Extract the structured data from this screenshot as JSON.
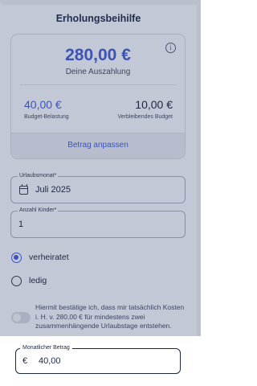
{
  "header": {
    "title": "Erholungsbeihilfe"
  },
  "summary": {
    "payout_amount": "280,00 €",
    "payout_label": "Deine Auszahlung",
    "budget_value": "40,00 €",
    "budget_label": "Budget-Belastung",
    "remaining_value": "10,00 €",
    "remaining_label": "Verbleibendes Budget",
    "adjust_button": "Betrag anpassen",
    "info_icon": "info-icon"
  },
  "form": {
    "vacation_month": {
      "label": "Urlaubsmonat*",
      "value": "Juli 2025",
      "icon": "calendar-icon"
    },
    "children": {
      "label": "Anzahl Kinder*",
      "value": "1"
    },
    "marital_status": {
      "options": [
        {
          "label": "verheiratet",
          "selected": true
        },
        {
          "label": "ledig",
          "selected": false
        }
      ]
    },
    "confirmation": {
      "text": "Hiermit bestätige ich, dass mir tatsächlich Kosten i. H. v. 280,00 € für mindestens zwei zusammenhängende Urlaubstage entstehen.",
      "checked": false
    }
  },
  "monthly": {
    "label": "Monatlicher Betrag",
    "currency": "€",
    "value": "40,00"
  },
  "colors": {
    "accent": "#3d53b4",
    "dark_text": "#1e2640",
    "overlay": "#c3c8d6"
  }
}
